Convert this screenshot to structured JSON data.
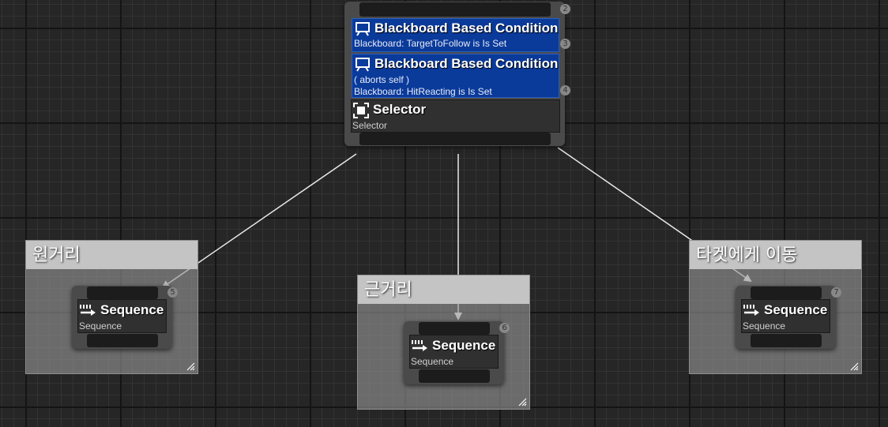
{
  "selector_node": {
    "index": "2",
    "decorators": [
      {
        "title": "Blackboard Based Condition",
        "lines": [
          "Blackboard: TargetToFollow is Is Set"
        ],
        "index": "3"
      },
      {
        "title": "Blackboard Based Condition",
        "lines": [
          "( aborts self )",
          "Blackboard: HitReacting is Is Set"
        ],
        "index": "4"
      }
    ],
    "composite": {
      "title": "Selector",
      "subtitle": "Selector"
    }
  },
  "comments": [
    {
      "title": "원거리",
      "node": {
        "title": "Sequence",
        "subtitle": "Sequence",
        "index": "5"
      }
    },
    {
      "title": "근거리",
      "node": {
        "title": "Sequence",
        "subtitle": "Sequence",
        "index": "6"
      }
    },
    {
      "title": "타겟에게 이동",
      "node": {
        "title": "Sequence",
        "subtitle": "Sequence",
        "index": "7"
      }
    }
  ],
  "icons": {
    "decorator": "decorator-icon",
    "selector": "selector-icon",
    "sequence": "sequence-icon"
  },
  "colors": {
    "decorator_bg": "#0a3a9a",
    "node_bg": "#4a4a4a",
    "graph_bg": "#262626",
    "comment_title_bg": "#c4c4c4"
  }
}
